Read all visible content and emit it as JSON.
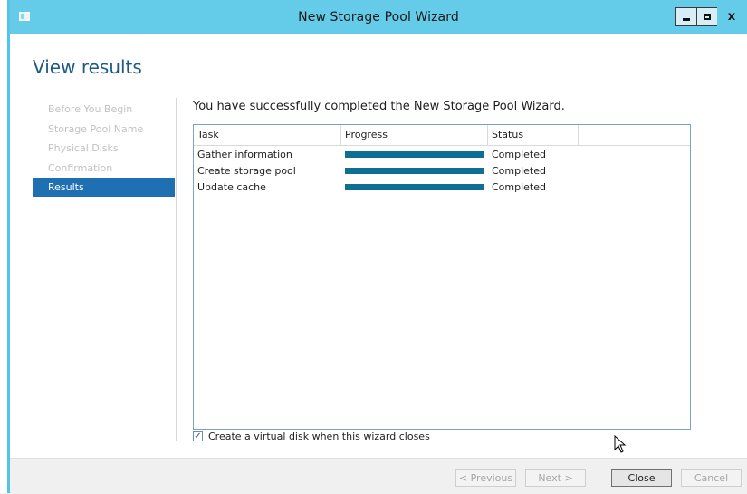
{
  "window": {
    "title": "New Storage Pool Wizard",
    "controls": {
      "minimize": "minimize-icon",
      "maximize": "maximize-icon",
      "close": "x"
    }
  },
  "page_title": "View results",
  "nav": {
    "items": [
      {
        "label": "Before You Begin",
        "active": false
      },
      {
        "label": "Storage Pool Name",
        "active": false
      },
      {
        "label": "Physical Disks",
        "active": false
      },
      {
        "label": "Confirmation",
        "active": false
      },
      {
        "label": "Results",
        "active": true
      }
    ]
  },
  "summary": "You have successfully completed the New Storage Pool Wizard.",
  "table": {
    "columns": [
      "Task",
      "Progress",
      "Status"
    ],
    "rows": [
      {
        "task": "Gather information",
        "progress": 1.0,
        "status": "Completed"
      },
      {
        "task": "Create storage pool",
        "progress": 1.0,
        "status": "Completed"
      },
      {
        "task": "Update cache",
        "progress": 1.0,
        "status": "Completed"
      }
    ]
  },
  "checkbox": {
    "label": "Create a virtual disk when this wizard closes",
    "checked": true
  },
  "buttons": {
    "previous": "< Previous",
    "next": "Next >",
    "close": "Close",
    "cancel": "Cancel"
  },
  "colors": {
    "titlebar": "#64cbe8",
    "accent": "#1f6fb3",
    "progress": "#0f6f93",
    "page_title": "#1c5a84"
  }
}
